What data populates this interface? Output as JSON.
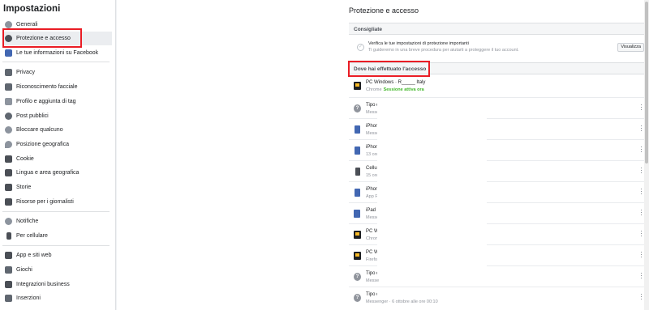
{
  "sidebar": {
    "title": "Impostazioni",
    "items": [
      {
        "label": "Generali",
        "icon": "gear-icon",
        "color": "#8d949e"
      },
      {
        "label": "Protezione e accesso",
        "icon": "shield-icon",
        "color": "#4b4f56"
      },
      {
        "label": "Le tue informazioni su Facebook",
        "icon": "facebook-icon",
        "color": "#4267b2"
      },
      {
        "label": "Privacy",
        "icon": "lock-icon",
        "color": "#606770"
      },
      {
        "label": "Riconoscimento facciale",
        "icon": "face-icon",
        "color": "#606770"
      },
      {
        "label": "Profilo e aggiunta di tag",
        "icon": "tag-icon",
        "color": "#8d949e"
      },
      {
        "label": "Post pubblici",
        "icon": "globe-icon",
        "color": "#606770"
      },
      {
        "label": "Bloccare qualcuno",
        "icon": "block-user-icon",
        "color": "#8d949e"
      },
      {
        "label": "Posizione geografica",
        "icon": "location-pin-icon",
        "color": "#8d949e"
      },
      {
        "label": "Cookie",
        "icon": "cookie-icon",
        "color": "#4b4f56"
      },
      {
        "label": "Lingua e area geografica",
        "icon": "language-icon",
        "color": "#4b4f56"
      },
      {
        "label": "Storie",
        "icon": "book-icon",
        "color": "#4b4f56"
      },
      {
        "label": "Risorse per i giornalisti",
        "icon": "journalist-icon",
        "color": "#4b4f56"
      },
      {
        "label": "Notifiche",
        "icon": "globe-notification-icon",
        "color": "#8d949e"
      },
      {
        "label": "Per cellulare",
        "icon": "mobile-icon",
        "color": "#4b4f56"
      },
      {
        "label": "App e siti web",
        "icon": "apps-icon",
        "color": "#4b4f56"
      },
      {
        "label": "Giochi",
        "icon": "gamepad-icon",
        "color": "#606770"
      },
      {
        "label": "Integrazioni business",
        "icon": "business-icon",
        "color": "#4b4f56"
      },
      {
        "label": "Inserzioni",
        "icon": "ads-icon",
        "color": "#606770"
      }
    ]
  },
  "panel": {
    "title": "Protezione e accesso",
    "recommended": {
      "heading": "Consigliate",
      "line1": "Verifica le tue impostazioni di protezione importanti",
      "line2": "Ti guideremo in una breve procedura per aiutarti a proteggere il tuo account.",
      "button": "Visualizza"
    },
    "where": {
      "heading": "Dove hai effettuato l'accesso",
      "devices": [
        {
          "icon": "pc-icon",
          "name": "PC Windows · R_____ Italy",
          "sub": "Chrome",
          "active": "Sessione attiva ora"
        },
        {
          "icon": "question-icon",
          "name": "Tipo d",
          "sub": "Messe",
          "active": ""
        },
        {
          "icon": "phone-icon",
          "name": "iPhone",
          "sub": "Messe",
          "active": ""
        },
        {
          "icon": "phone-icon",
          "name": "iPhone",
          "sub": "13 ore",
          "active": ""
        },
        {
          "icon": "mobile-icon",
          "name": "Cellul",
          "sub": "15 ore",
          "active": ""
        },
        {
          "icon": "phone-icon",
          "name": "iPhone",
          "sub": "App F",
          "active": ""
        },
        {
          "icon": "tablet-icon",
          "name": "iPad S",
          "sub": "Messe",
          "active": ""
        },
        {
          "icon": "pc-icon",
          "name": "PC W",
          "sub": "Chrom",
          "active": ""
        },
        {
          "icon": "pc-icon",
          "name": "PC W",
          "sub": "Firefo",
          "active": ""
        },
        {
          "icon": "question-icon",
          "name": "Tipo d",
          "sub": "Messe",
          "active": ""
        },
        {
          "icon": "question-icon",
          "name": "Tipo d",
          "sub": "Messenger · 6 ottobre alle ore 00:10",
          "active": ""
        }
      ]
    }
  },
  "colors": {
    "highlight": "#ea1d25",
    "active_session": "#42b72a",
    "accent": "#4267b2"
  }
}
